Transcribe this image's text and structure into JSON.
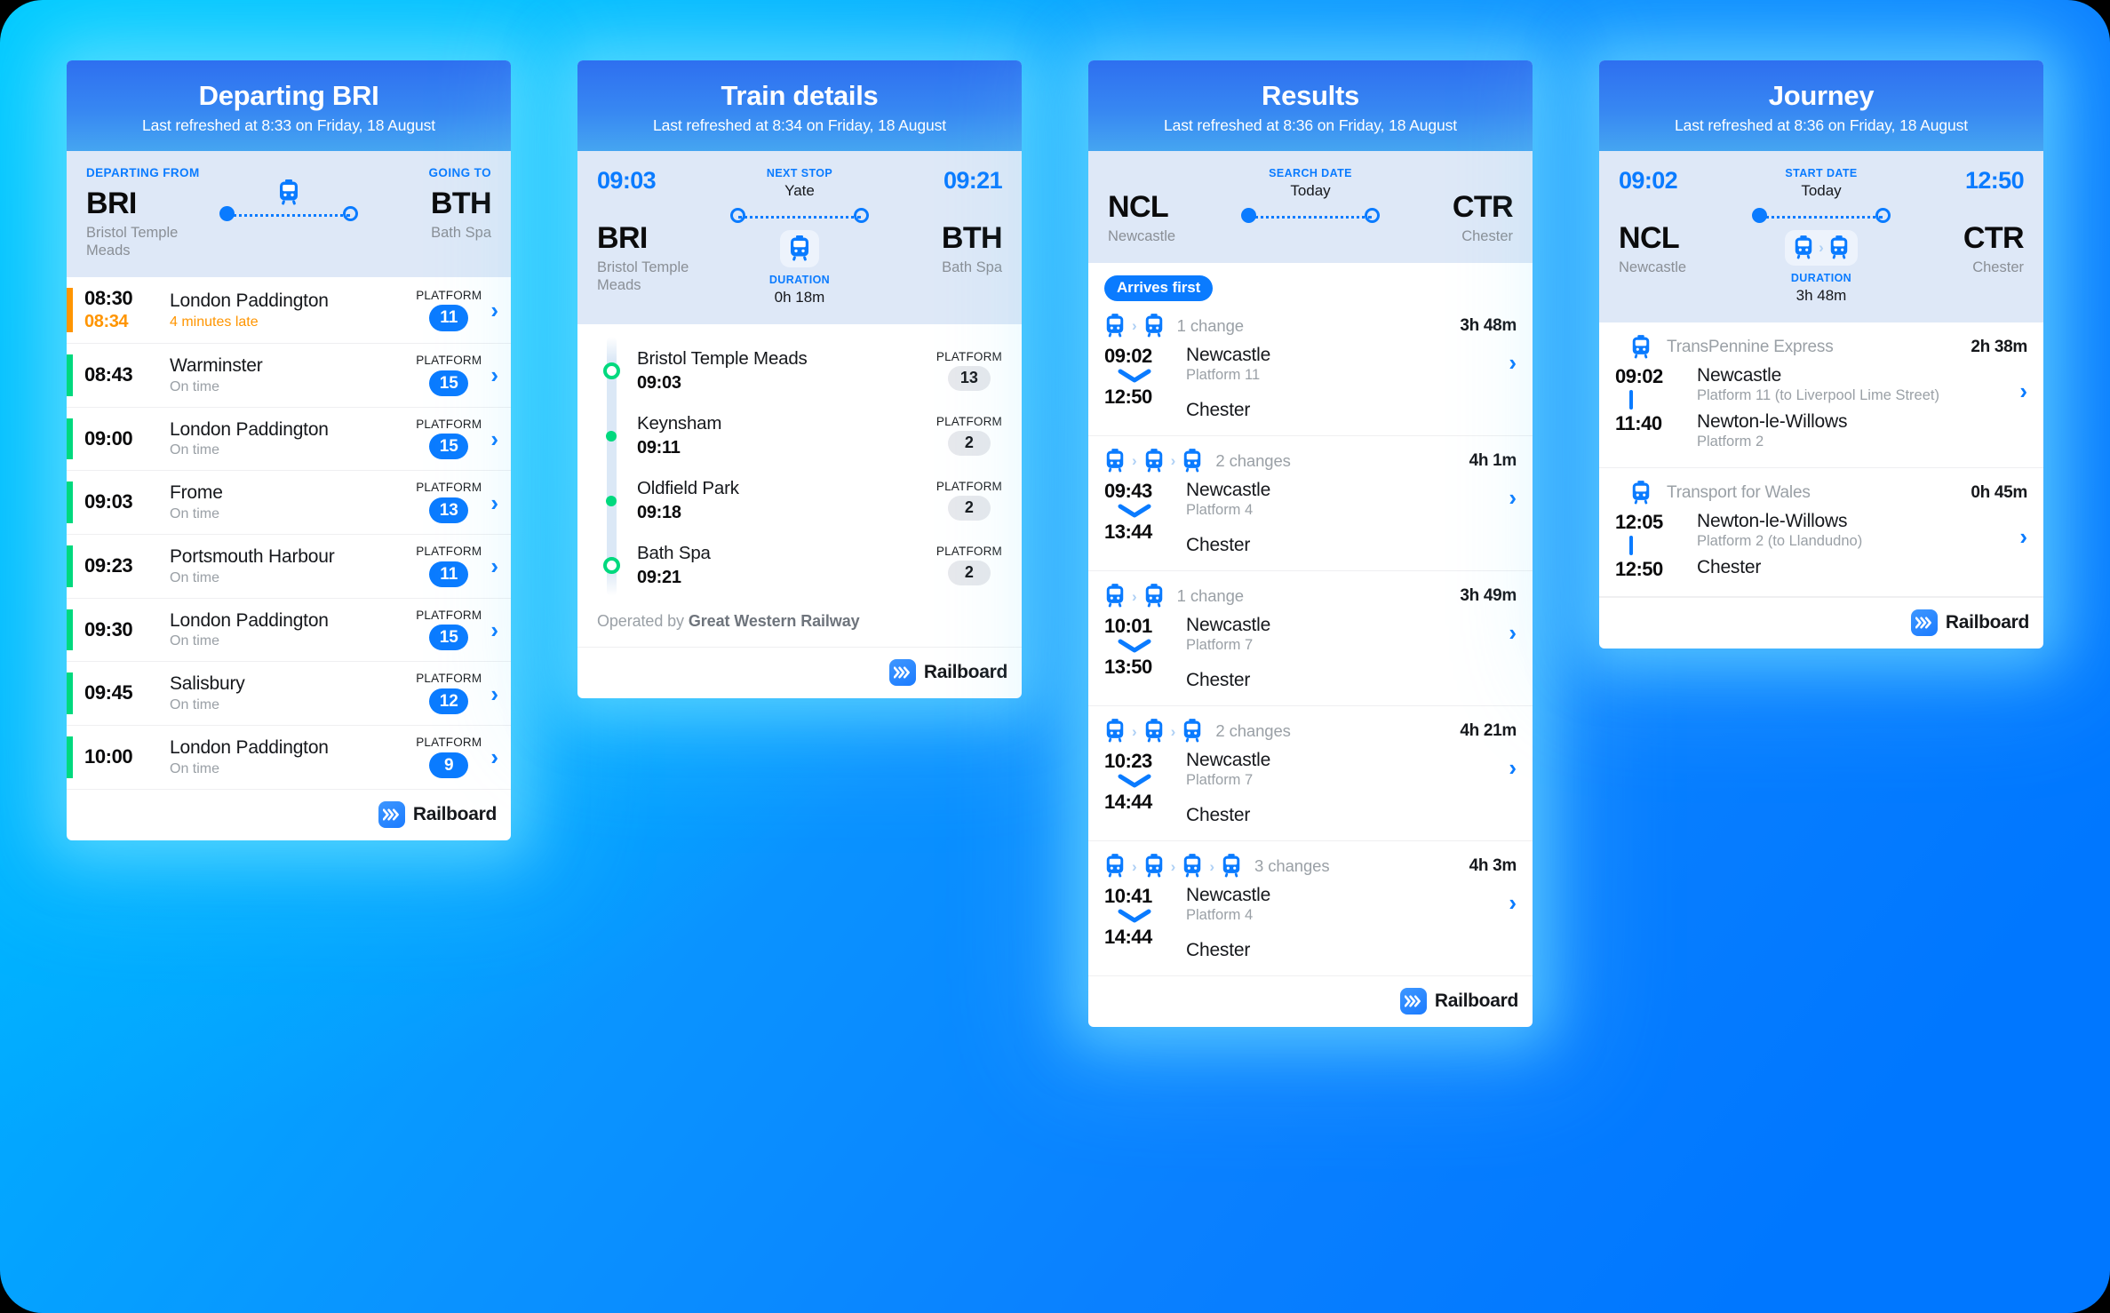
{
  "theme": {
    "accent_blue": "#0A7BFF",
    "late_orange": "#FF9500",
    "ontime_green": "#00D97E",
    "background_from": "#00C6FF",
    "background_to": "#0077FF"
  },
  "brand": {
    "name": "Railboard",
    "logo_icon": "chevrons-right-icon"
  },
  "cards": [
    {
      "id": "departures",
      "header": {
        "title": "Departing BRI",
        "subtitle": "Last refreshed at 8:33 on Friday, 18 August"
      },
      "route": {
        "left_kicker": "DEPARTING FROM",
        "left_code": "BRI",
        "left_name": "Bristol Temple Meads",
        "right_kicker": "GOING TO",
        "right_code": "BTH",
        "right_name": "Bath Spa"
      },
      "departures": [
        {
          "time": "08:30",
          "expected": "08:34",
          "destination": "London Paddington",
          "status": "4 minutes late",
          "late": true,
          "platform_label": "PLATFORM",
          "platform": "11"
        },
        {
          "time": "08:43",
          "expected": "",
          "destination": "Warminster",
          "status": "On time",
          "late": false,
          "platform_label": "PLATFORM",
          "platform": "15"
        },
        {
          "time": "09:00",
          "expected": "",
          "destination": "London Paddington",
          "status": "On time",
          "late": false,
          "platform_label": "PLATFORM",
          "platform": "15"
        },
        {
          "time": "09:03",
          "expected": "",
          "destination": "Frome",
          "status": "On time",
          "late": false,
          "platform_label": "PLATFORM",
          "platform": "13"
        },
        {
          "time": "09:23",
          "expected": "",
          "destination": "Portsmouth Harbour",
          "status": "On time",
          "late": false,
          "platform_label": "PLATFORM",
          "platform": "11"
        },
        {
          "time": "09:30",
          "expected": "",
          "destination": "London Paddington",
          "status": "On time",
          "late": false,
          "platform_label": "PLATFORM",
          "platform": "15"
        },
        {
          "time": "09:45",
          "expected": "",
          "destination": "Salisbury",
          "status": "On time",
          "late": false,
          "platform_label": "PLATFORM",
          "platform": "12"
        },
        {
          "time": "10:00",
          "expected": "",
          "destination": "London Paddington",
          "status": "On time",
          "late": false,
          "platform_label": "PLATFORM",
          "platform": "9"
        }
      ]
    },
    {
      "id": "train-details",
      "header": {
        "title": "Train details",
        "subtitle": "Last refreshed at 8:34 on Friday, 18 August"
      },
      "route": {
        "left_time": "09:03",
        "right_time": "09:21",
        "mid_kicker": "NEXT STOP",
        "mid_value": "Yate",
        "left_code": "BRI",
        "left_name": "Bristol Temple Meads",
        "right_code": "BTH",
        "right_name": "Bath Spa",
        "duration_label": "DURATION",
        "duration": "0h 18m"
      },
      "stops": [
        {
          "name": "Bristol Temple Meads",
          "time": "09:03",
          "platform_label": "PLATFORM",
          "platform": "13",
          "marker": "ring"
        },
        {
          "name": "Keynsham",
          "time": "09:11",
          "platform_label": "PLATFORM",
          "platform": "2",
          "marker": "dot"
        },
        {
          "name": "Oldfield Park",
          "time": "09:18",
          "platform_label": "PLATFORM",
          "platform": "2",
          "marker": "dot"
        },
        {
          "name": "Bath Spa",
          "time": "09:21",
          "platform_label": "PLATFORM",
          "platform": "2",
          "marker": "ring"
        }
      ],
      "operated_prefix": "Operated by ",
      "operator": "Great Western Railway"
    },
    {
      "id": "results",
      "header": {
        "title": "Results",
        "subtitle": "Last refreshed at 8:36 on Friday, 18 August"
      },
      "route": {
        "left_code": "NCL",
        "left_name": "Newcastle",
        "right_code": "CTR",
        "right_name": "Chester",
        "mid_kicker": "SEARCH DATE",
        "mid_value": "Today"
      },
      "badge": "Arrives first",
      "results": [
        {
          "legs": 2,
          "changes": "1 change",
          "duration": "3h 48m",
          "dep_time": "09:02",
          "dep_station": "Newcastle",
          "dep_platform": "Platform 11",
          "arr_time": "12:50",
          "arr_station": "Chester"
        },
        {
          "legs": 3,
          "changes": "2 changes",
          "duration": "4h 1m",
          "dep_time": "09:43",
          "dep_station": "Newcastle",
          "dep_platform": "Platform 4",
          "arr_time": "13:44",
          "arr_station": "Chester"
        },
        {
          "legs": 2,
          "changes": "1 change",
          "duration": "3h 49m",
          "dep_time": "10:01",
          "dep_station": "Newcastle",
          "dep_platform": "Platform 7",
          "arr_time": "13:50",
          "arr_station": "Chester"
        },
        {
          "legs": 3,
          "changes": "2 changes",
          "duration": "4h 21m",
          "dep_time": "10:23",
          "dep_station": "Newcastle",
          "dep_platform": "Platform 7",
          "arr_time": "14:44",
          "arr_station": "Chester"
        },
        {
          "legs": 4,
          "changes": "3 changes",
          "duration": "4h 3m",
          "dep_time": "10:41",
          "dep_station": "Newcastle",
          "dep_platform": "Platform 4",
          "arr_time": "14:44",
          "arr_station": "Chester"
        }
      ]
    },
    {
      "id": "journey",
      "header": {
        "title": "Journey",
        "subtitle": "Last refreshed at 8:36 on Friday, 18 August"
      },
      "route": {
        "left_time": "09:02",
        "right_time": "12:50",
        "mid_kicker": "START DATE",
        "mid_value": "Today",
        "left_code": "NCL",
        "left_name": "Newcastle",
        "right_code": "CTR",
        "right_name": "Chester",
        "duration_label": "DURATION",
        "duration": "3h 48m"
      },
      "legs": [
        {
          "operator": "TransPennine Express",
          "duration": "2h 38m",
          "dep_time": "09:02",
          "dep_station": "Newcastle",
          "dep_platform": "Platform 11 (to Liverpool Lime Street)",
          "arr_time": "11:40",
          "arr_station": "Newton-le-Willows",
          "arr_platform": "Platform 2"
        },
        {
          "operator": "Transport for Wales",
          "duration": "0h 45m",
          "dep_time": "12:05",
          "dep_station": "Newton-le-Willows",
          "dep_platform": "Platform 2 (to Llandudno)",
          "arr_time": "12:50",
          "arr_station": "Chester",
          "arr_platform": ""
        }
      ]
    }
  ]
}
